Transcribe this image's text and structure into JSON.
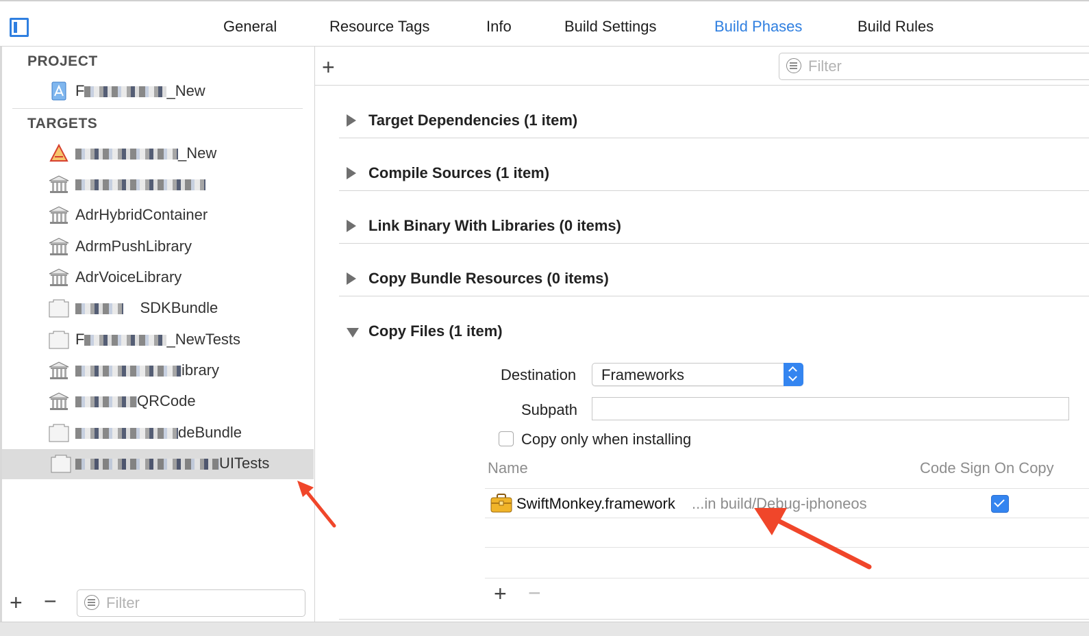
{
  "tabs": [
    {
      "label": "General",
      "active": false
    },
    {
      "label": "Resource Tags",
      "active": false
    },
    {
      "label": "Info",
      "active": false
    },
    {
      "label": "Build Settings",
      "active": false
    },
    {
      "label": "Build Phases",
      "active": true
    },
    {
      "label": "Build Rules",
      "active": false
    }
  ],
  "accent_color": "#2f7fe0",
  "sidebar": {
    "project_title": "PROJECT",
    "project_item": {
      "prefix": "F",
      "suffix": "_New",
      "icon": "xcode-project-icon"
    },
    "targets_title": "TARGETS",
    "targets": [
      {
        "prefix": "",
        "suffix": "_New",
        "icon": "app-target-icon"
      },
      {
        "prefix": "",
        "suffix": "",
        "icon": "framework-icon"
      },
      {
        "prefix": "",
        "suffix": "AdrHybridContainer",
        "icon": "framework-icon"
      },
      {
        "prefix": "",
        "suffix": "AdrmPushLibrary",
        "icon": "framework-icon"
      },
      {
        "prefix": "",
        "suffix": "AdrVoiceLibrary",
        "icon": "framework-icon"
      },
      {
        "prefix": "",
        "suffix": "SDKBundle",
        "icon": "bundle-icon"
      },
      {
        "prefix": "F",
        "suffix": "_NewTests",
        "icon": "bundle-icon"
      },
      {
        "prefix": "",
        "suffix": "ibrary",
        "icon": "framework-icon"
      },
      {
        "prefix": "",
        "suffix": "QRCode",
        "icon": "framework-icon"
      },
      {
        "prefix": "",
        "suffix": "deBundle",
        "icon": "bundle-icon"
      },
      {
        "prefix": "",
        "suffix": "UITests",
        "icon": "bundle-icon",
        "selected": true
      }
    ],
    "filter_placeholder": "Filter"
  },
  "main": {
    "filter_placeholder": "Filter",
    "phases": [
      {
        "title": "Target Dependencies (1 item)",
        "expanded": false
      },
      {
        "title": "Compile Sources (1 item)",
        "expanded": false
      },
      {
        "title": "Link Binary With Libraries (0 items)",
        "expanded": false
      },
      {
        "title": "Copy Bundle Resources (0 items)",
        "expanded": false
      },
      {
        "title": "Copy Files (1 item)",
        "expanded": true
      }
    ],
    "copy_files": {
      "destination_label": "Destination",
      "destination_value": "Frameworks",
      "subpath_label": "Subpath",
      "subpath_value": "",
      "copy_only_label": "Copy only when installing",
      "copy_only_checked": false,
      "col_name": "Name",
      "col_code_sign": "Code Sign On Copy",
      "files": [
        {
          "name": "SwiftMonkey.framework",
          "location": "...in build/Debug-iphoneos",
          "code_sign": true,
          "icon": "framework-toolbox-icon"
        }
      ]
    }
  },
  "annotation_color": "#f0462a"
}
